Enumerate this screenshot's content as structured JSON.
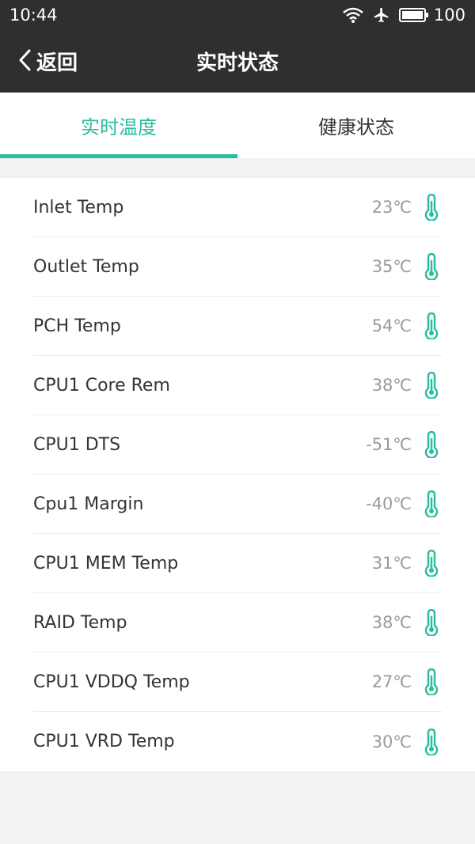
{
  "status_bar": {
    "time": "10:44",
    "battery": "100",
    "icons": [
      "wifi-icon",
      "airplane-icon",
      "battery-icon"
    ]
  },
  "nav": {
    "back_label": "返回",
    "title": "实时状态",
    "back_icon": "chevron-left-icon"
  },
  "tabs": [
    {
      "label": "实时温度",
      "active": true
    },
    {
      "label": "健康状态",
      "active": false
    }
  ],
  "colors": {
    "accent": "#2bbd9f",
    "header_bg": "#2f2f2f",
    "value_text": "#9a9a9a"
  },
  "temperatures": [
    {
      "label": "Inlet Temp",
      "value": "23℃"
    },
    {
      "label": "Outlet Temp",
      "value": "35℃"
    },
    {
      "label": "PCH Temp",
      "value": "54℃"
    },
    {
      "label": "CPU1 Core Rem",
      "value": "38℃"
    },
    {
      "label": "CPU1 DTS",
      "value": "-51℃"
    },
    {
      "label": "Cpu1 Margin",
      "value": "-40℃"
    },
    {
      "label": "CPU1 MEM Temp",
      "value": "31℃"
    },
    {
      "label": "RAID Temp",
      "value": "38℃"
    },
    {
      "label": "CPU1 VDDQ Temp",
      "value": "27℃"
    },
    {
      "label": "CPU1 VRD Temp",
      "value": "30℃"
    }
  ]
}
